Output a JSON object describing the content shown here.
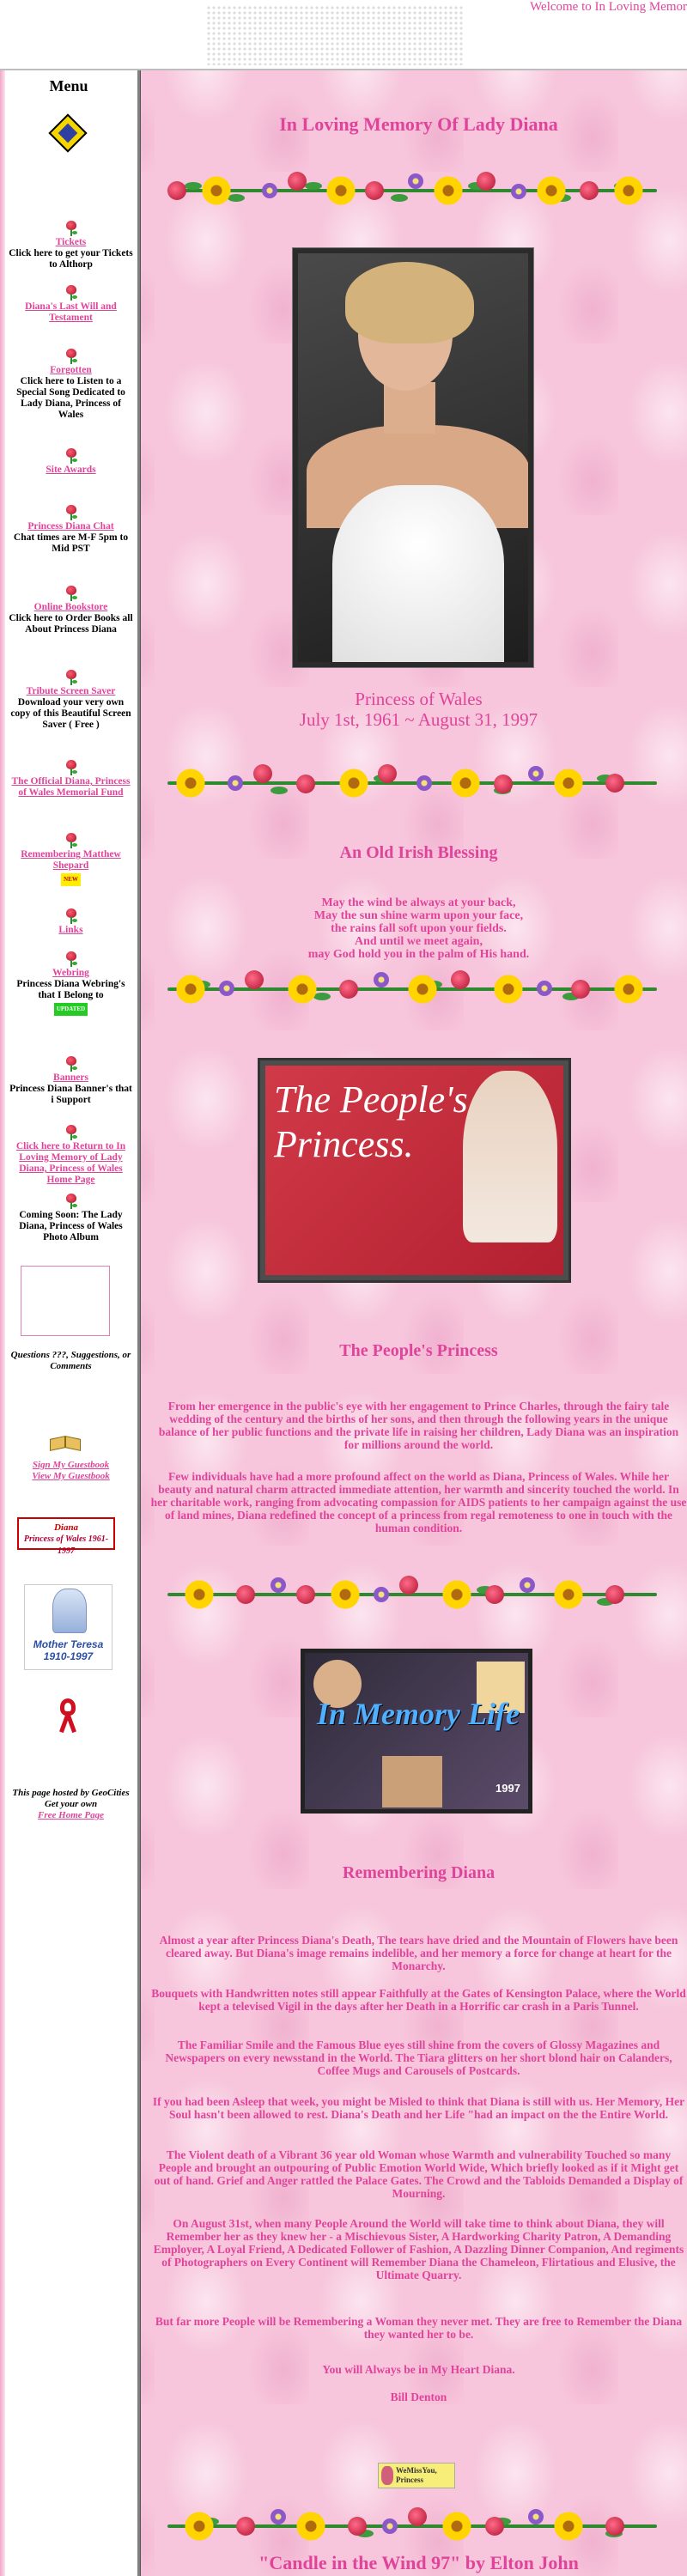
{
  "header": {
    "welcome": "Welcome to In Loving Memor"
  },
  "sidebar": {
    "title": "Menu",
    "items": [
      {
        "link": "Tickets",
        "text": "Click here to get your Tickets to Althorp"
      },
      {
        "link": "Diana's Last Will and Testament",
        "text": ""
      },
      {
        "link": "Forgotten",
        "text": "Click here to Listen to a Special Song Dedicated to Lady Diana, Princess of Wales"
      },
      {
        "link": "Site Awards",
        "text": ""
      },
      {
        "link": "Princess Diana Chat",
        "text": "Chat times are M-F 5pm to Mid PST"
      },
      {
        "link": "Online Bookstore",
        "text": "Click here to Order Books all About Princess Diana"
      },
      {
        "link": "Tribute Screen Saver",
        "text": "Download your very own copy of this Beautiful Screen Saver ( Free )"
      },
      {
        "link": "The Official Diana, Princess of Wales Memorial Fund",
        "text": ""
      },
      {
        "link": "Remembering Matthew Shepard",
        "text": "",
        "badge": "NEW"
      },
      {
        "link": "Links",
        "text": ""
      },
      {
        "link": "Webring",
        "text": "Princess Diana Webring's that I Belong to",
        "badge": "UPDATED"
      },
      {
        "link": "Banners",
        "text": "Princess Diana Banner's that i Support"
      },
      {
        "link": "Click here to Return to In Loving Memory of Lady Diana, Princess of Wales Home Page",
        "text": ""
      },
      {
        "link": "",
        "text": "Coming Soon: The Lady Diana, Princess of Wales Photo Album"
      }
    ],
    "questions": "Questions ???, Suggestions, or Comments",
    "guestbook_sign": "Sign My Guestbook",
    "guestbook_view": "View My Guestbook",
    "diana_banner_l1": "Diana",
    "diana_banner_l2": "Princess of Wales 1961-1997",
    "teresa_l1": "Mother Teresa",
    "teresa_l2": "1910-1997",
    "geocities_text": "This page hosted by GeoCities   Get your own",
    "geocities_link": "Free Home Page"
  },
  "main": {
    "title": "In Loving Memory Of Lady Diana",
    "princess_line": "Princess of Wales",
    "dates_line": "July 1st, 1961 ~ August 31, 1997",
    "blessing_title": "An Old Irish Blessing",
    "blessing": [
      "May the wind be always at your back,",
      "May the sun shine warm upon your face,",
      "the rains fall soft upon your fields.",
      "And until we meet again,",
      "may God hold you in the palm of His hand."
    ],
    "peoples_banner": "The People's Princess.",
    "peoples_title": "The People's Princess",
    "peoples_p1": "From her emergence in the public's eye with her engagement to Prince Charles, through the fairy tale wedding of the century and the births of her sons, and then through the following years in the unique balance of her public functions and the private life in raising her children, Lady Diana was an inspiration for millions around the world.",
    "peoples_p2": "Few individuals have had a more profound affect on the world as Diana, Princess of Wales. While her beauty and natural charm attracted immediate attention, her warmth and sincerity touched the world. In her charitable work, ranging from advocating compassion for AIDS patients to her campaign against the use of land mines, Diana redefined the concept of a princess from regal remoteness to one in touch with the human condition.",
    "memory_image_text": "In Memory Life",
    "memory_image_year": "1997",
    "remembering_title": "Remembering Diana",
    "remembering": [
      "Almost a year after Princess Diana's Death, The tears have dried and the Mountain of Flowers have been cleared away. But Diana's image remains indelible, and her memory a force for change at heart for the Monarchy.",
      "Bouquets with Handwritten notes still appear Faithfully at the Gates of Kensington Palace, where the World kept a televised Vigil in the days after her Death in a Horrific car crash in a Paris Tunnel.",
      "The Familiar Smile and the Famous Blue eyes still shine from the covers of Glossy Magazines and Newspapers on every newsstand in the World. The Tiara glitters on her short blond hair on Calanders, Coffee Mugs and Carousels of Postcards.",
      "If you had been Asleep that week, you might be Misled to think that Diana is still with us. Her Memory, Her Soul hasn't been allowed to rest. Diana's Death and her Life \"had an impact on the the Entire World.",
      "The Violent death of a Vibrant 36 year old Woman whose Warmth and vulnerability Touched so many People and brought an outpouring of Public Emotion World Wide, Which briefly looked as if it Might get out of hand. Grief and Anger rattled the Palace Gates. The Crowd and the Tabloids Demanded a Display of Mourning.",
      "On August 31st, when many People Around the World will take time to think about Diana, they will Remember her as they knew her - a Mischievous Sister, A Hardworking Charity Patron, A Demanding Employer, A Loyal Friend, A Dedicated Follower of Fashion, A Dazzling Dinner Companion, And regiments of Photographers on Every Continent will Remember Diana the Chameleon, Flirtatious and Elusive, the Ultimate Quarry.",
      "But far more People will be Remembering a Woman they never met. They are free to Remember the Diana they wanted her to be.",
      "You will Always be in My Heart Diana."
    ],
    "signature": "Bill Denton",
    "wemiss": "WeMissYou, Princess",
    "candle_title": "\"Candle in the Wind 97\" by Elton John"
  }
}
